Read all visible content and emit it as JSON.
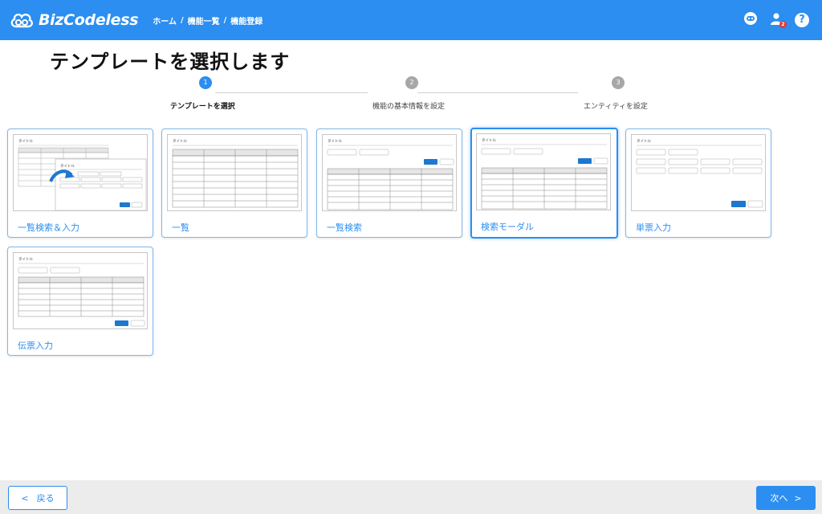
{
  "header": {
    "brand": "BizCodeless",
    "breadcrumbs": [
      "ホーム",
      "機能一覧",
      "機能登録"
    ],
    "separator": "/",
    "notification_count": "2",
    "help_glyph": "?",
    "icons": [
      "logo-icon",
      "assistant-icon",
      "user-icon",
      "help-icon"
    ]
  },
  "page": {
    "title": "テンプレートを選択します"
  },
  "stepper": {
    "steps": [
      {
        "number": "1",
        "label": "テンプレートを選択",
        "state": "active"
      },
      {
        "number": "2",
        "label": "機能の基本情報を設定",
        "state": "todo"
      },
      {
        "number": "3",
        "label": "エンティティを設定",
        "state": "todo"
      }
    ]
  },
  "templates": [
    {
      "label": "一覧検索＆入力",
      "thumb_title": "タイトル",
      "thumb_title_2": "タイトル",
      "selected": false
    },
    {
      "label": "一覧",
      "thumb_title": "タイトル",
      "selected": false
    },
    {
      "label": "一覧検索",
      "thumb_title": "タイトル",
      "selected": false
    },
    {
      "label": "検索モーダル",
      "thumb_title": "タイトル",
      "selected": true
    },
    {
      "label": "単票入力",
      "thumb_title": "タイトル",
      "selected": false
    },
    {
      "label": "伝票入力",
      "thumb_title": "タイトル",
      "selected": false
    }
  ],
  "footer": {
    "back_label": "戻る",
    "back_chevron": "<",
    "next_label": "次へ",
    "next_chevron": ">"
  },
  "colors": {
    "primary": "#2b8ef0",
    "badge": "#e53935",
    "footer_bg": "#ececec"
  }
}
